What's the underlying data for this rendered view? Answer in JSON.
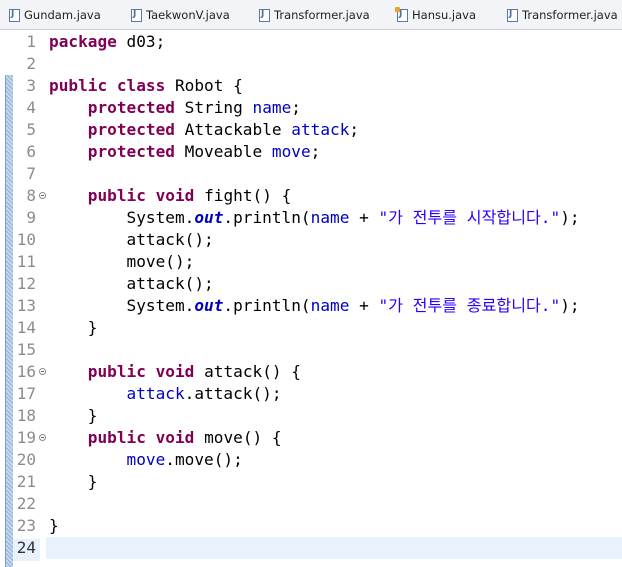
{
  "tabs": [
    {
      "label": "Gundam.java",
      "icon": "java-file-icon"
    },
    {
      "label": "TaekwonV.java",
      "icon": "java-file-icon"
    },
    {
      "label": "Transformer.java",
      "icon": "java-file-icon"
    },
    {
      "label": "Hansu.java",
      "icon": "java-interface-file-icon"
    },
    {
      "label": "Transformer.java",
      "icon": "java-file-icon"
    }
  ],
  "colors": {
    "keyword": "#7f0055",
    "field": "#0000c0",
    "string": "#2a00ff",
    "current_line": "#e8f2fe"
  },
  "editor": {
    "current_line": 24,
    "lines": [
      {
        "n": "1",
        "t": [
          {
            "k": "kw",
            "v": "package"
          },
          {
            "k": "pl",
            "v": " d03;"
          }
        ]
      },
      {
        "n": "2",
        "t": []
      },
      {
        "n": "3",
        "t": [
          {
            "k": "kw",
            "v": "public"
          },
          {
            "k": "pl",
            "v": " "
          },
          {
            "k": "kw",
            "v": "class"
          },
          {
            "k": "pl",
            "v": " Robot {"
          }
        ]
      },
      {
        "n": "4",
        "t": [
          {
            "k": "pl",
            "v": "    "
          },
          {
            "k": "kw",
            "v": "protected"
          },
          {
            "k": "pl",
            "v": " String "
          },
          {
            "k": "fld",
            "v": "name"
          },
          {
            "k": "pl",
            "v": ";"
          }
        ]
      },
      {
        "n": "5",
        "t": [
          {
            "k": "pl",
            "v": "    "
          },
          {
            "k": "kw",
            "v": "protected"
          },
          {
            "k": "pl",
            "v": " Attackable "
          },
          {
            "k": "fld",
            "v": "attack"
          },
          {
            "k": "pl",
            "v": ";"
          }
        ]
      },
      {
        "n": "6",
        "t": [
          {
            "k": "pl",
            "v": "    "
          },
          {
            "k": "kw",
            "v": "protected"
          },
          {
            "k": "pl",
            "v": " Moveable "
          },
          {
            "k": "fld",
            "v": "move"
          },
          {
            "k": "pl",
            "v": ";"
          }
        ]
      },
      {
        "n": "7",
        "t": []
      },
      {
        "n": "8",
        "fold": true,
        "t": [
          {
            "k": "pl",
            "v": "    "
          },
          {
            "k": "kw",
            "v": "public"
          },
          {
            "k": "pl",
            "v": " "
          },
          {
            "k": "kw",
            "v": "void"
          },
          {
            "k": "pl",
            "v": " fight() {"
          }
        ]
      },
      {
        "n": "9",
        "t": [
          {
            "k": "pl",
            "v": "        System."
          },
          {
            "k": "sta",
            "v": "out"
          },
          {
            "k": "pl",
            "v": ".println("
          },
          {
            "k": "fld",
            "v": "name"
          },
          {
            "k": "pl",
            "v": " + "
          },
          {
            "k": "str",
            "v": "\"가 전투를 시작합니다.\""
          },
          {
            "k": "pl",
            "v": ");"
          }
        ]
      },
      {
        "n": "10",
        "t": [
          {
            "k": "pl",
            "v": "        attack();"
          }
        ]
      },
      {
        "n": "11",
        "t": [
          {
            "k": "pl",
            "v": "        move();"
          }
        ]
      },
      {
        "n": "12",
        "t": [
          {
            "k": "pl",
            "v": "        attack();"
          }
        ]
      },
      {
        "n": "13",
        "t": [
          {
            "k": "pl",
            "v": "        System."
          },
          {
            "k": "sta",
            "v": "out"
          },
          {
            "k": "pl",
            "v": ".println("
          },
          {
            "k": "fld",
            "v": "name"
          },
          {
            "k": "pl",
            "v": " + "
          },
          {
            "k": "str",
            "v": "\"가 전투를 종료합니다.\""
          },
          {
            "k": "pl",
            "v": ");"
          }
        ]
      },
      {
        "n": "14",
        "t": [
          {
            "k": "pl",
            "v": "    }"
          }
        ]
      },
      {
        "n": "15",
        "t": []
      },
      {
        "n": "16",
        "fold": true,
        "t": [
          {
            "k": "pl",
            "v": "    "
          },
          {
            "k": "kw",
            "v": "public"
          },
          {
            "k": "pl",
            "v": " "
          },
          {
            "k": "kw",
            "v": "void"
          },
          {
            "k": "pl",
            "v": " attack() {"
          }
        ]
      },
      {
        "n": "17",
        "t": [
          {
            "k": "pl",
            "v": "        "
          },
          {
            "k": "fld",
            "v": "attack"
          },
          {
            "k": "pl",
            "v": ".attack();"
          }
        ]
      },
      {
        "n": "18",
        "t": [
          {
            "k": "pl",
            "v": "    }"
          }
        ]
      },
      {
        "n": "19",
        "fold": true,
        "t": [
          {
            "k": "pl",
            "v": "    "
          },
          {
            "k": "kw",
            "v": "public"
          },
          {
            "k": "pl",
            "v": " "
          },
          {
            "k": "kw",
            "v": "void"
          },
          {
            "k": "pl",
            "v": " move() {"
          }
        ]
      },
      {
        "n": "20",
        "t": [
          {
            "k": "pl",
            "v": "        "
          },
          {
            "k": "fld",
            "v": "move"
          },
          {
            "k": "pl",
            "v": ".move();"
          }
        ]
      },
      {
        "n": "21",
        "t": [
          {
            "k": "pl",
            "v": "    }"
          }
        ]
      },
      {
        "n": "22",
        "t": []
      },
      {
        "n": "23",
        "t": [
          {
            "k": "pl",
            "v": "}"
          }
        ]
      },
      {
        "n": "24",
        "t": []
      }
    ]
  }
}
